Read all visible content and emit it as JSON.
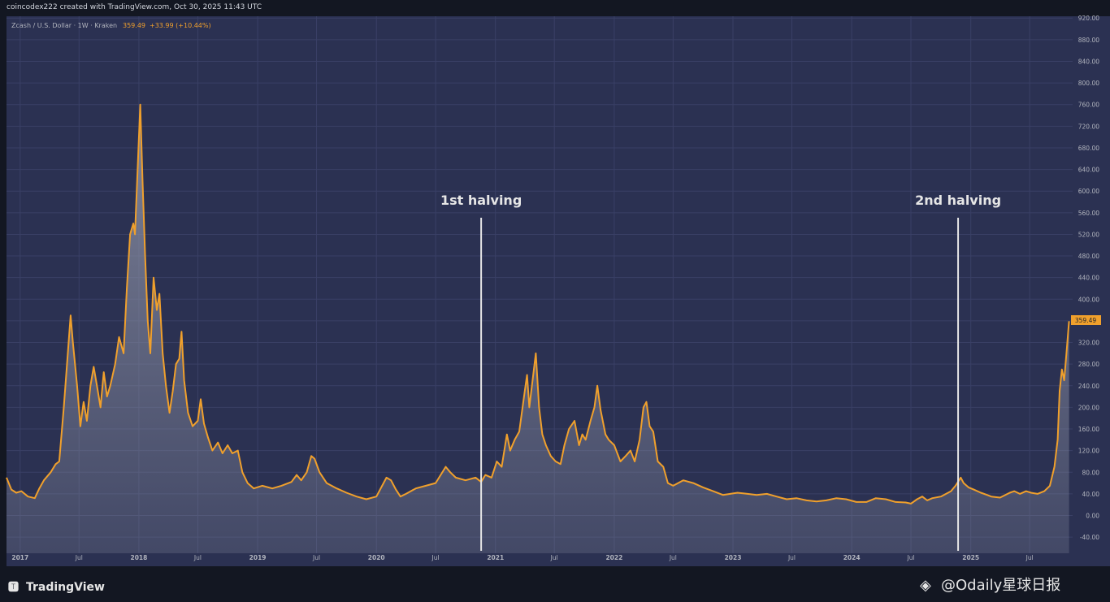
{
  "header": {
    "created_by": "coincodex222 created with TradingView.com, Oct 30, 2025 11:43 UTC"
  },
  "legend": {
    "symbol": "Zcash / U.S. Dollar · 1W · Kraken",
    "last": "359.49",
    "change": "+33.99 (+10.44%)"
  },
  "price_tag": "359.49",
  "annotations": [
    {
      "label": "1st halving",
      "date": "2020-11-18"
    },
    {
      "label": "2nd halving",
      "date": "2024-11-23"
    }
  ],
  "footer": {
    "brand": "TradingView",
    "watermark": "@Odaily星球日报"
  },
  "colors": {
    "background": "#2b3152",
    "line": "#f0a02c",
    "area": "#8a8fa3",
    "halving_line": "#e6e6e6",
    "price_tag_bg": "#f0a02c"
  },
  "chart_data": {
    "type": "area",
    "title": "",
    "xlabel": "",
    "ylabel": "",
    "x_range": [
      "2016-11-20",
      "2025-11-10"
    ],
    "ylim": [
      -50,
      920
    ],
    "y_ticks": [
      920,
      880,
      840,
      800,
      760,
      720,
      680,
      640,
      600,
      560,
      520,
      480,
      440,
      400,
      360,
      320,
      280,
      240,
      200,
      160,
      120,
      80,
      40,
      0,
      -40
    ],
    "y_tick_labels": [
      "920.00",
      "880.00",
      "840.00",
      "800.00",
      "760.00",
      "720.00",
      "680.00",
      "640.00",
      "600.00",
      "560.00",
      "520.00",
      "480.00",
      "440.00",
      "400.00",
      "360.00",
      "320.00",
      "280.00",
      "240.00",
      "200.00",
      "160.00",
      "120.00",
      "80.00",
      "40.00",
      "0.00",
      "-40.00"
    ],
    "x_ticks": [
      {
        "label": "2017",
        "date": "2017-01-01"
      },
      {
        "label": "Jul",
        "date": "2017-07-01"
      },
      {
        "label": "2018",
        "date": "2018-01-01"
      },
      {
        "label": "Jul",
        "date": "2018-07-01"
      },
      {
        "label": "2019",
        "date": "2019-01-01"
      },
      {
        "label": "Jul",
        "date": "2019-07-01"
      },
      {
        "label": "2020",
        "date": "2020-01-01"
      },
      {
        "label": "Jul",
        "date": "2020-07-01"
      },
      {
        "label": "2021",
        "date": "2021-01-01"
      },
      {
        "label": "Jul",
        "date": "2021-07-01"
      },
      {
        "label": "2022",
        "date": "2022-01-01"
      },
      {
        "label": "Jul",
        "date": "2022-07-01"
      },
      {
        "label": "2023",
        "date": "2023-01-01"
      },
      {
        "label": "Jul",
        "date": "2023-07-01"
      },
      {
        "label": "2024",
        "date": "2024-01-01"
      },
      {
        "label": "Jul",
        "date": "2024-07-01"
      },
      {
        "label": "2025",
        "date": "2025-01-01"
      },
      {
        "label": "Jul",
        "date": "2025-07-01"
      }
    ],
    "grid": true,
    "series": [
      {
        "name": "Zcash / U.S. Dollar",
        "points": [
          [
            "2016-11-20",
            70
          ],
          [
            "2016-12-05",
            48
          ],
          [
            "2016-12-20",
            42
          ],
          [
            "2017-01-05",
            45
          ],
          [
            "2017-01-25",
            35
          ],
          [
            "2017-02-15",
            32
          ],
          [
            "2017-03-01",
            50
          ],
          [
            "2017-03-15",
            65
          ],
          [
            "2017-04-05",
            80
          ],
          [
            "2017-04-20",
            95
          ],
          [
            "2017-05-01",
            100
          ],
          [
            "2017-05-15",
            200
          ],
          [
            "2017-05-28",
            305
          ],
          [
            "2017-06-05",
            370
          ],
          [
            "2017-06-12",
            320
          ],
          [
            "2017-06-25",
            240
          ],
          [
            "2017-07-05",
            165
          ],
          [
            "2017-07-15",
            210
          ],
          [
            "2017-07-25",
            175
          ],
          [
            "2017-08-05",
            240
          ],
          [
            "2017-08-15",
            275
          ],
          [
            "2017-08-25",
            240
          ],
          [
            "2017-09-05",
            200
          ],
          [
            "2017-09-15",
            265
          ],
          [
            "2017-09-25",
            220
          ],
          [
            "2017-10-05",
            240
          ],
          [
            "2017-10-20",
            280
          ],
          [
            "2017-11-01",
            330
          ],
          [
            "2017-11-15",
            300
          ],
          [
            "2017-11-25",
            420
          ],
          [
            "2017-12-05",
            520
          ],
          [
            "2017-12-15",
            540
          ],
          [
            "2017-12-20",
            520
          ],
          [
            "2018-01-05",
            760
          ],
          [
            "2018-01-12",
            620
          ],
          [
            "2018-01-20",
            480
          ],
          [
            "2018-01-28",
            360
          ],
          [
            "2018-02-05",
            300
          ],
          [
            "2018-02-15",
            440
          ],
          [
            "2018-02-25",
            380
          ],
          [
            "2018-03-05",
            410
          ],
          [
            "2018-03-15",
            300
          ],
          [
            "2018-03-25",
            240
          ],
          [
            "2018-04-05",
            190
          ],
          [
            "2018-04-15",
            230
          ],
          [
            "2018-04-25",
            280
          ],
          [
            "2018-05-05",
            290
          ],
          [
            "2018-05-12",
            340
          ],
          [
            "2018-05-20",
            250
          ],
          [
            "2018-06-01",
            190
          ],
          [
            "2018-06-15",
            165
          ],
          [
            "2018-07-01",
            175
          ],
          [
            "2018-07-10",
            215
          ],
          [
            "2018-07-20",
            170
          ],
          [
            "2018-08-01",
            145
          ],
          [
            "2018-08-15",
            120
          ],
          [
            "2018-09-01",
            135
          ],
          [
            "2018-09-15",
            115
          ],
          [
            "2018-10-01",
            130
          ],
          [
            "2018-10-15",
            115
          ],
          [
            "2018-11-01",
            120
          ],
          [
            "2018-11-15",
            80
          ],
          [
            "2018-12-01",
            60
          ],
          [
            "2018-12-20",
            50
          ],
          [
            "2019-01-15",
            55
          ],
          [
            "2019-02-15",
            50
          ],
          [
            "2019-03-15",
            55
          ],
          [
            "2019-04-15",
            62
          ],
          [
            "2019-05-01",
            75
          ],
          [
            "2019-05-15",
            65
          ],
          [
            "2019-06-01",
            80
          ],
          [
            "2019-06-15",
            110
          ],
          [
            "2019-06-25",
            105
          ],
          [
            "2019-07-10",
            80
          ],
          [
            "2019-08-01",
            60
          ],
          [
            "2019-09-01",
            50
          ],
          [
            "2019-10-01",
            42
          ],
          [
            "2019-11-01",
            35
          ],
          [
            "2019-12-01",
            30
          ],
          [
            "2020-01-01",
            35
          ],
          [
            "2020-02-01",
            70
          ],
          [
            "2020-02-15",
            65
          ],
          [
            "2020-03-01",
            48
          ],
          [
            "2020-03-15",
            35
          ],
          [
            "2020-04-01",
            40
          ],
          [
            "2020-05-01",
            50
          ],
          [
            "2020-06-01",
            55
          ],
          [
            "2020-07-01",
            60
          ],
          [
            "2020-08-01",
            90
          ],
          [
            "2020-08-15",
            80
          ],
          [
            "2020-09-01",
            70
          ],
          [
            "2020-10-01",
            65
          ],
          [
            "2020-11-01",
            70
          ],
          [
            "2020-11-18",
            62
          ],
          [
            "2020-12-01",
            75
          ],
          [
            "2020-12-20",
            70
          ],
          [
            "2021-01-05",
            100
          ],
          [
            "2021-01-20",
            90
          ],
          [
            "2021-02-05",
            150
          ],
          [
            "2021-02-15",
            120
          ],
          [
            "2021-03-01",
            140
          ],
          [
            "2021-03-15",
            155
          ],
          [
            "2021-04-01",
            230
          ],
          [
            "2021-04-08",
            260
          ],
          [
            "2021-04-15",
            200
          ],
          [
            "2021-04-25",
            250
          ],
          [
            "2021-05-05",
            300
          ],
          [
            "2021-05-15",
            200
          ],
          [
            "2021-05-25",
            150
          ],
          [
            "2021-06-05",
            130
          ],
          [
            "2021-06-20",
            110
          ],
          [
            "2021-07-05",
            100
          ],
          [
            "2021-07-20",
            95
          ],
          [
            "2021-08-01",
            130
          ],
          [
            "2021-08-15",
            160
          ],
          [
            "2021-09-01",
            175
          ],
          [
            "2021-09-15",
            130
          ],
          [
            "2021-09-25",
            150
          ],
          [
            "2021-10-05",
            140
          ],
          [
            "2021-10-20",
            175
          ],
          [
            "2021-11-01",
            200
          ],
          [
            "2021-11-10",
            240
          ],
          [
            "2021-11-20",
            195
          ],
          [
            "2021-12-05",
            150
          ],
          [
            "2021-12-15",
            140
          ],
          [
            "2022-01-01",
            130
          ],
          [
            "2022-01-20",
            100
          ],
          [
            "2022-02-05",
            110
          ],
          [
            "2022-02-20",
            120
          ],
          [
            "2022-03-05",
            100
          ],
          [
            "2022-03-20",
            140
          ],
          [
            "2022-04-01",
            200
          ],
          [
            "2022-04-10",
            210
          ],
          [
            "2022-04-20",
            165
          ],
          [
            "2022-05-01",
            155
          ],
          [
            "2022-05-15",
            100
          ],
          [
            "2022-06-01",
            90
          ],
          [
            "2022-06-15",
            60
          ],
          [
            "2022-07-01",
            55
          ],
          [
            "2022-08-01",
            65
          ],
          [
            "2022-09-01",
            60
          ],
          [
            "2022-10-01",
            52
          ],
          [
            "2022-11-01",
            45
          ],
          [
            "2022-12-01",
            38
          ],
          [
            "2023-01-15",
            42
          ],
          [
            "2023-02-15",
            40
          ],
          [
            "2023-03-15",
            38
          ],
          [
            "2023-04-15",
            40
          ],
          [
            "2023-05-15",
            35
          ],
          [
            "2023-06-15",
            30
          ],
          [
            "2023-07-15",
            32
          ],
          [
            "2023-08-15",
            28
          ],
          [
            "2023-09-15",
            26
          ],
          [
            "2023-10-15",
            28
          ],
          [
            "2023-11-15",
            32
          ],
          [
            "2023-12-15",
            30
          ],
          [
            "2024-01-15",
            25
          ],
          [
            "2024-02-15",
            25
          ],
          [
            "2024-03-15",
            32
          ],
          [
            "2024-04-15",
            30
          ],
          [
            "2024-05-15",
            25
          ],
          [
            "2024-06-15",
            24
          ],
          [
            "2024-07-01",
            22
          ],
          [
            "2024-07-20",
            30
          ],
          [
            "2024-08-05",
            35
          ],
          [
            "2024-08-20",
            28
          ],
          [
            "2024-09-05",
            32
          ],
          [
            "2024-10-01",
            35
          ],
          [
            "2024-11-01",
            45
          ],
          [
            "2024-11-15",
            55
          ],
          [
            "2024-12-01",
            70
          ],
          [
            "2024-12-10",
            60
          ],
          [
            "2024-12-25",
            52
          ],
          [
            "2025-01-10",
            48
          ],
          [
            "2025-02-01",
            42
          ],
          [
            "2025-02-20",
            38
          ],
          [
            "2025-03-05",
            35
          ],
          [
            "2025-04-01",
            33
          ],
          [
            "2025-05-01",
            42
          ],
          [
            "2025-05-15",
            45
          ],
          [
            "2025-06-01",
            40
          ],
          [
            "2025-06-20",
            45
          ],
          [
            "2025-07-05",
            42
          ],
          [
            "2025-07-25",
            40
          ],
          [
            "2025-08-15",
            45
          ],
          [
            "2025-09-01",
            55
          ],
          [
            "2025-09-15",
            90
          ],
          [
            "2025-09-25",
            140
          ],
          [
            "2025-10-01",
            230
          ],
          [
            "2025-10-08",
            270
          ],
          [
            "2025-10-15",
            250
          ],
          [
            "2025-10-22",
            300
          ],
          [
            "2025-10-30",
            359.49
          ]
        ]
      }
    ]
  }
}
